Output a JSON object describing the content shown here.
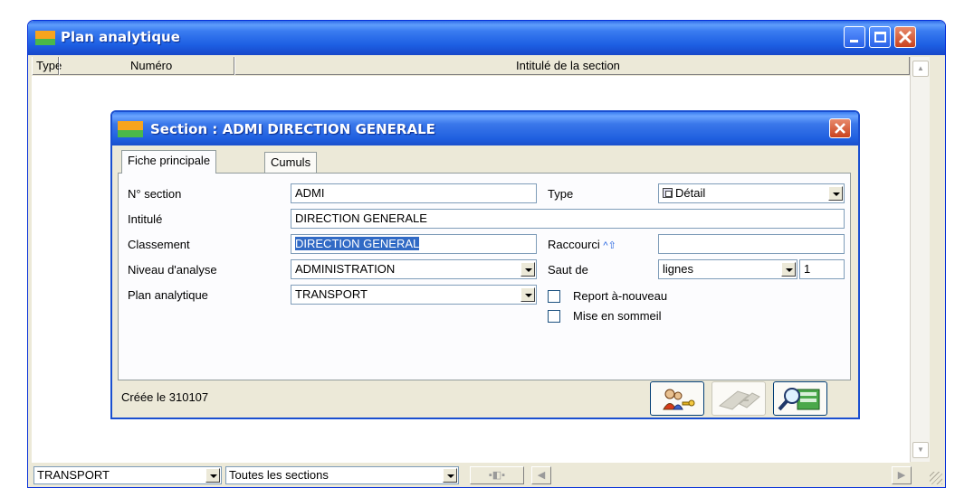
{
  "outer_window": {
    "title": "Plan analytique",
    "columns": [
      "Type",
      "Numéro",
      "Intitulé de la section"
    ]
  },
  "status_bar": {
    "plan_filter": "TRANSPORT",
    "section_filter": "Toutes les sections"
  },
  "dialog": {
    "title": "Section : ADMI DIRECTION GENERALE",
    "tabs": [
      "Fiche principale",
      "Cumuls"
    ],
    "form": {
      "num_section_label": "N° section",
      "num_section_value": "ADMI",
      "intitule_label": "Intitulé",
      "intitule_value": "DIRECTION GENERALE",
      "classement_label": "Classement",
      "classement_value": "DIRECTION GENERAL",
      "niveau_label": "Niveau d'analyse",
      "niveau_value": "ADMINISTRATION",
      "plan_label": "Plan analytique",
      "plan_value": "TRANSPORT",
      "type_label": "Type",
      "type_value": "Détail",
      "raccourci_label": "Raccourci",
      "raccourci_value": "",
      "saut_label": "Saut de",
      "saut_unit": "lignes",
      "saut_value": "1",
      "report_label": "Report à-nouveau",
      "sommeil_label": "Mise en sommeil"
    },
    "created_text": "Créée le 310107"
  },
  "colors": {
    "titlebar": "#1d5fe3",
    "dialog_face": "#ece9d8",
    "selection": "#316ac5",
    "close_button": "#c9421e"
  }
}
